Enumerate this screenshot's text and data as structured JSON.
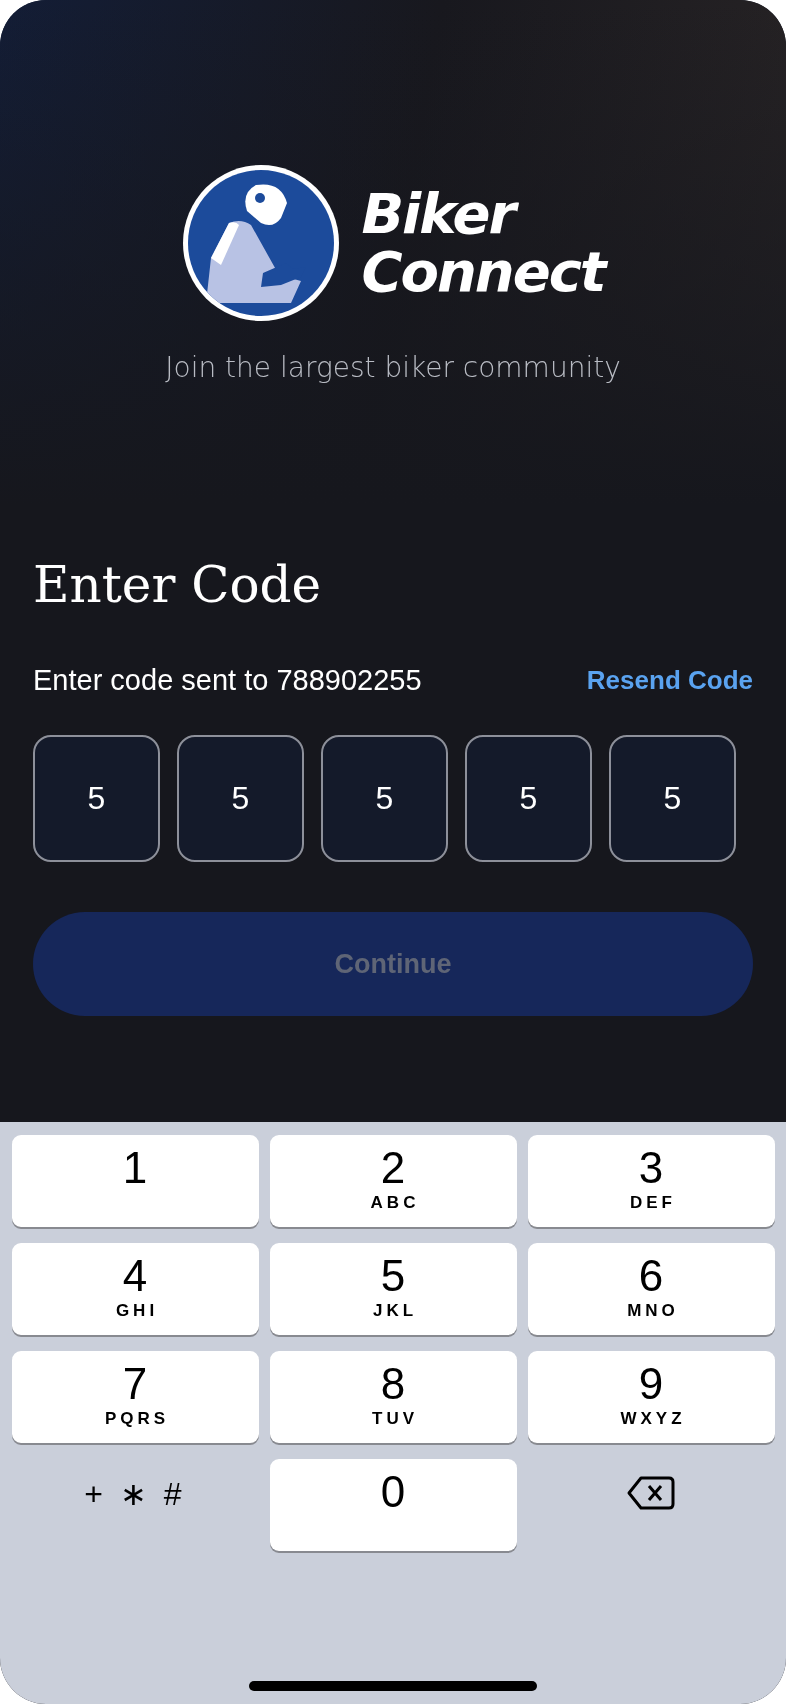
{
  "brand": {
    "name_line_1": "Biker",
    "name_line_2": "Connect",
    "tagline": "Join the largest biker community"
  },
  "heading": "Enter Code",
  "sent_to": "Enter code sent to 788902255",
  "resend_link": "Resend Code",
  "code_digits": [
    "5",
    "5",
    "5",
    "5",
    "5"
  ],
  "continue_button": {
    "label": "Continue",
    "disabled": true
  },
  "keypad": [
    {
      "kind": "digit",
      "digit": "1"
    },
    {
      "kind": "digit",
      "digit": "2",
      "letters": "ABC"
    },
    {
      "kind": "digit",
      "digit": "3",
      "letters": "DEF"
    },
    {
      "kind": "digit",
      "digit": "4",
      "letters": "GHI"
    },
    {
      "kind": "digit",
      "digit": "5",
      "letters": "JKL"
    },
    {
      "kind": "digit",
      "digit": "6",
      "letters": "MNO"
    },
    {
      "kind": "digit",
      "digit": "7",
      "letters": "PQRS"
    },
    {
      "kind": "digit",
      "digit": "8",
      "letters": "TUV"
    },
    {
      "kind": "digit",
      "digit": "9",
      "letters": "WXYZ"
    },
    {
      "kind": "symbols",
      "label": "+ ∗ #"
    },
    {
      "kind": "digit",
      "digit": "0"
    },
    {
      "kind": "delete"
    }
  ]
}
